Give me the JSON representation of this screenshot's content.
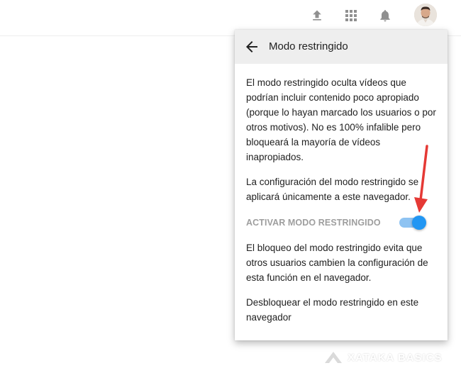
{
  "topbar": {
    "icons": [
      "upload-icon",
      "apps-grid-icon",
      "bell-icon",
      "avatar"
    ]
  },
  "dialog": {
    "title": "Modo restringido",
    "back_icon": "arrow-left-icon",
    "paragraph1": "El modo restringido oculta vídeos que podrían incluir contenido poco apropiado (porque lo hayan marcado los usuarios o por otros motivos). No es 100% infalible pero bloqueará la mayoría de vídeos inapropiados.",
    "paragraph2": "La configuración del modo restringido se aplicará únicamente a este navegador.",
    "toggle_label": "ACTIVAR MODO RESTRINGIDO",
    "toggle_on": true,
    "paragraph3": "El bloqueo del modo restringido evita que otros usuarios cambien la configuración de esta función en el navegador.",
    "paragraph4": "Desbloquear el modo restringido en este navegador"
  },
  "watermark": {
    "text": "XATAKA BASICS"
  },
  "colors": {
    "accent": "#2196f3",
    "track": "#8ec3f2",
    "header_bg": "#eeeeee",
    "annotation": "#e53935",
    "icon_gray": "#909090"
  }
}
